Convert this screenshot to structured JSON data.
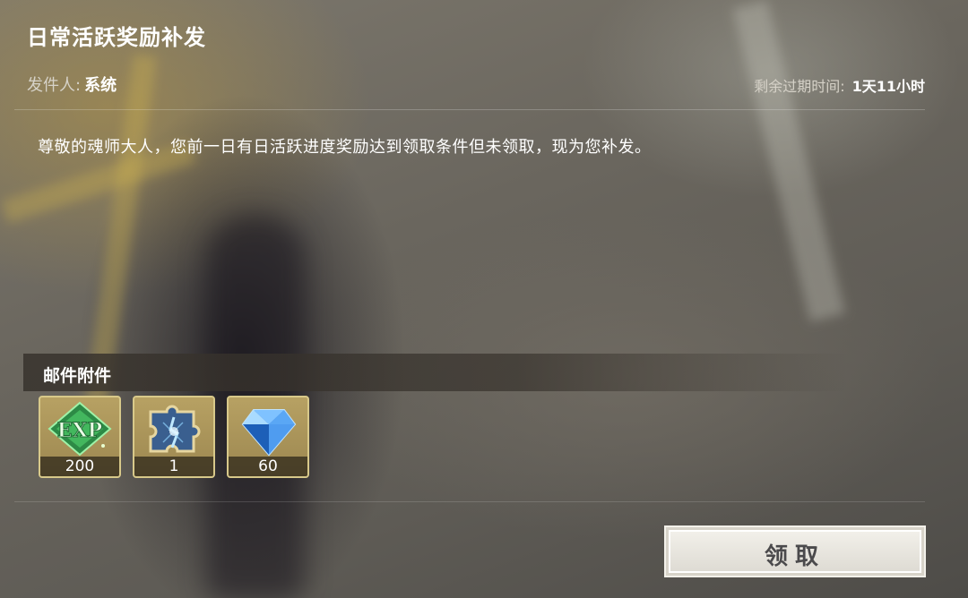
{
  "mail": {
    "title": "日常活跃奖励补发",
    "sender_label": "发件人:",
    "sender_name": "系统",
    "expire_label": "剩余过期时间:",
    "expire_value": "1天11小时",
    "body": "尊敬的魂师大人，您前一日有日活跃进度奖励达到领取条件但未领取，现为您补发。"
  },
  "attachments": {
    "title": "邮件附件",
    "items": [
      {
        "icon": "exp-icon",
        "icon_text": "EXP",
        "count": "200"
      },
      {
        "icon": "puzzle-piece-icon",
        "count": "1"
      },
      {
        "icon": "diamond-icon",
        "count": "60"
      }
    ]
  },
  "actions": {
    "claim_label": "领取"
  },
  "colors": {
    "item_border": "#d8c98a",
    "exp_green": "#3fbf5a",
    "gem_blue": "#3f86e0",
    "button_text": "#4b4a4c"
  }
}
